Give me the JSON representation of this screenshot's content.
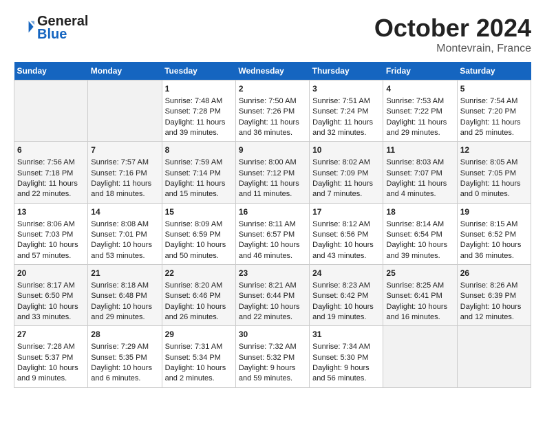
{
  "header": {
    "logo_line1": "General",
    "logo_line2": "Blue",
    "month": "October 2024",
    "location": "Montevrain, France"
  },
  "weekdays": [
    "Sunday",
    "Monday",
    "Tuesday",
    "Wednesday",
    "Thursday",
    "Friday",
    "Saturday"
  ],
  "weeks": [
    [
      {
        "day": "",
        "content": ""
      },
      {
        "day": "",
        "content": ""
      },
      {
        "day": "1",
        "content": "Sunrise: 7:48 AM\nSunset: 7:28 PM\nDaylight: 11 hours and 39 minutes."
      },
      {
        "day": "2",
        "content": "Sunrise: 7:50 AM\nSunset: 7:26 PM\nDaylight: 11 hours and 36 minutes."
      },
      {
        "day": "3",
        "content": "Sunrise: 7:51 AM\nSunset: 7:24 PM\nDaylight: 11 hours and 32 minutes."
      },
      {
        "day": "4",
        "content": "Sunrise: 7:53 AM\nSunset: 7:22 PM\nDaylight: 11 hours and 29 minutes."
      },
      {
        "day": "5",
        "content": "Sunrise: 7:54 AM\nSunset: 7:20 PM\nDaylight: 11 hours and 25 minutes."
      }
    ],
    [
      {
        "day": "6",
        "content": "Sunrise: 7:56 AM\nSunset: 7:18 PM\nDaylight: 11 hours and 22 minutes."
      },
      {
        "day": "7",
        "content": "Sunrise: 7:57 AM\nSunset: 7:16 PM\nDaylight: 11 hours and 18 minutes."
      },
      {
        "day": "8",
        "content": "Sunrise: 7:59 AM\nSunset: 7:14 PM\nDaylight: 11 hours and 15 minutes."
      },
      {
        "day": "9",
        "content": "Sunrise: 8:00 AM\nSunset: 7:12 PM\nDaylight: 11 hours and 11 minutes."
      },
      {
        "day": "10",
        "content": "Sunrise: 8:02 AM\nSunset: 7:09 PM\nDaylight: 11 hours and 7 minutes."
      },
      {
        "day": "11",
        "content": "Sunrise: 8:03 AM\nSunset: 7:07 PM\nDaylight: 11 hours and 4 minutes."
      },
      {
        "day": "12",
        "content": "Sunrise: 8:05 AM\nSunset: 7:05 PM\nDaylight: 11 hours and 0 minutes."
      }
    ],
    [
      {
        "day": "13",
        "content": "Sunrise: 8:06 AM\nSunset: 7:03 PM\nDaylight: 10 hours and 57 minutes."
      },
      {
        "day": "14",
        "content": "Sunrise: 8:08 AM\nSunset: 7:01 PM\nDaylight: 10 hours and 53 minutes."
      },
      {
        "day": "15",
        "content": "Sunrise: 8:09 AM\nSunset: 6:59 PM\nDaylight: 10 hours and 50 minutes."
      },
      {
        "day": "16",
        "content": "Sunrise: 8:11 AM\nSunset: 6:57 PM\nDaylight: 10 hours and 46 minutes."
      },
      {
        "day": "17",
        "content": "Sunrise: 8:12 AM\nSunset: 6:56 PM\nDaylight: 10 hours and 43 minutes."
      },
      {
        "day": "18",
        "content": "Sunrise: 8:14 AM\nSunset: 6:54 PM\nDaylight: 10 hours and 39 minutes."
      },
      {
        "day": "19",
        "content": "Sunrise: 8:15 AM\nSunset: 6:52 PM\nDaylight: 10 hours and 36 minutes."
      }
    ],
    [
      {
        "day": "20",
        "content": "Sunrise: 8:17 AM\nSunset: 6:50 PM\nDaylight: 10 hours and 33 minutes."
      },
      {
        "day": "21",
        "content": "Sunrise: 8:18 AM\nSunset: 6:48 PM\nDaylight: 10 hours and 29 minutes."
      },
      {
        "day": "22",
        "content": "Sunrise: 8:20 AM\nSunset: 6:46 PM\nDaylight: 10 hours and 26 minutes."
      },
      {
        "day": "23",
        "content": "Sunrise: 8:21 AM\nSunset: 6:44 PM\nDaylight: 10 hours and 22 minutes."
      },
      {
        "day": "24",
        "content": "Sunrise: 8:23 AM\nSunset: 6:42 PM\nDaylight: 10 hours and 19 minutes."
      },
      {
        "day": "25",
        "content": "Sunrise: 8:25 AM\nSunset: 6:41 PM\nDaylight: 10 hours and 16 minutes."
      },
      {
        "day": "26",
        "content": "Sunrise: 8:26 AM\nSunset: 6:39 PM\nDaylight: 10 hours and 12 minutes."
      }
    ],
    [
      {
        "day": "27",
        "content": "Sunrise: 7:28 AM\nSunset: 5:37 PM\nDaylight: 10 hours and 9 minutes."
      },
      {
        "day": "28",
        "content": "Sunrise: 7:29 AM\nSunset: 5:35 PM\nDaylight: 10 hours and 6 minutes."
      },
      {
        "day": "29",
        "content": "Sunrise: 7:31 AM\nSunset: 5:34 PM\nDaylight: 10 hours and 2 minutes."
      },
      {
        "day": "30",
        "content": "Sunrise: 7:32 AM\nSunset: 5:32 PM\nDaylight: 9 hours and 59 minutes."
      },
      {
        "day": "31",
        "content": "Sunrise: 7:34 AM\nSunset: 5:30 PM\nDaylight: 9 hours and 56 minutes."
      },
      {
        "day": "",
        "content": ""
      },
      {
        "day": "",
        "content": ""
      }
    ]
  ]
}
